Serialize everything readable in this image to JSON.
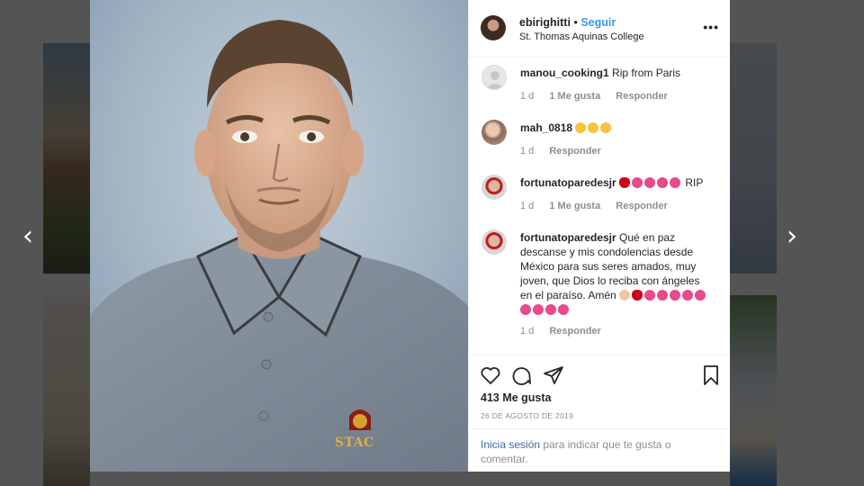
{
  "post": {
    "username": "ebirighitti",
    "separator": "•",
    "follow_label": "Seguir",
    "location": "St. Thomas Aquinas College",
    "more_label": "•••",
    "shirt_logo_text": "STAC"
  },
  "comments": [
    {
      "user": "manou_cooking1",
      "text": "Rip from Paris",
      "time": "1 d",
      "likes": "1 Me gusta",
      "reply": "Responder"
    },
    {
      "user": "mah_0818",
      "text": "",
      "time": "1 d",
      "likes": "",
      "reply": "Responder"
    },
    {
      "user": "fortunatoparedesjr",
      "text": "RIP",
      "time": "1 d",
      "likes": "1 Me gusta",
      "reply": "Responder"
    },
    {
      "user": "fortunatoparedesjr",
      "text": "Qué en paz descanse y mis condolencias desde México para sus seres amados, muy joven, que Dios lo reciba con ángeles en el paraíso. Amén",
      "time": "1 d",
      "likes": "",
      "reply": "Responder"
    }
  ],
  "actions": {
    "likes_count": "413 Me gusta",
    "date": "26 DE AGOSTO DE 2019"
  },
  "login": {
    "link": "Inicia sesión",
    "text": " para indicar que te gusta o comentar."
  },
  "nav": {
    "prev": "‹",
    "next": "›"
  },
  "icons": [
    "heart-icon",
    "comment-icon",
    "share-icon",
    "bookmark-icon",
    "more-icon"
  ],
  "colors": {
    "follow": "#3897f0",
    "muted": "#8e8e8e",
    "text": "#262626",
    "heart_emoji": "#d0021b",
    "tulip_emoji": "#e84a8a"
  }
}
